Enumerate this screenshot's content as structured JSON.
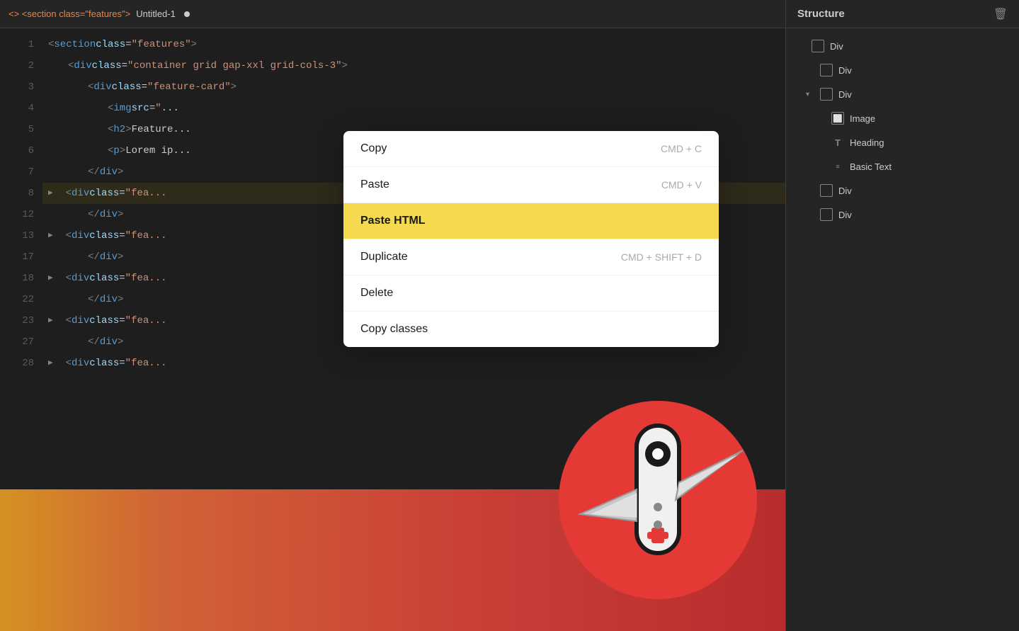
{
  "tab": {
    "chevron_label": "<> <section class=\"features\">",
    "filename": "Untitled-1",
    "dot": true
  },
  "editor": {
    "lines": [
      {
        "num": "1",
        "indent": 0,
        "arrow": false,
        "code": "<section class=\"features\">"
      },
      {
        "num": "2",
        "indent": 1,
        "arrow": false,
        "code": "<div class=\"container grid gap-xxl grid-cols-3\">"
      },
      {
        "num": "3",
        "indent": 2,
        "arrow": false,
        "code": "<div class=\"feature-card\">"
      },
      {
        "num": "4",
        "indent": 3,
        "arrow": false,
        "code": "<img src=\"..."
      },
      {
        "num": "5",
        "indent": 3,
        "arrow": false,
        "code": "<h2>Feature..."
      },
      {
        "num": "6",
        "indent": 3,
        "arrow": false,
        "code": "<p>Lorem ip..."
      },
      {
        "num": "7",
        "indent": 2,
        "arrow": false,
        "code": "</div>"
      },
      {
        "num": "8",
        "indent": 1,
        "arrow": true,
        "code": "<div class=\"fea..."
      },
      {
        "num": "12",
        "indent": 2,
        "arrow": false,
        "code": "</div>"
      },
      {
        "num": "13",
        "indent": 1,
        "arrow": true,
        "code": "<div class=\"fea..."
      },
      {
        "num": "17",
        "indent": 2,
        "arrow": false,
        "code": "</div>"
      },
      {
        "num": "18",
        "indent": 1,
        "arrow": true,
        "code": "<div class=\"fea..."
      },
      {
        "num": "22",
        "indent": 2,
        "arrow": false,
        "code": "</div>"
      },
      {
        "num": "23",
        "indent": 1,
        "arrow": true,
        "code": "<div class=\"fea..."
      },
      {
        "num": "27",
        "indent": 2,
        "arrow": false,
        "code": "</div>"
      },
      {
        "num": "28",
        "indent": 1,
        "arrow": true,
        "code": "<div class=\"fea..."
      }
    ]
  },
  "context_menu": {
    "items": [
      {
        "label": "Copy",
        "shortcut": "CMD + C",
        "active": false
      },
      {
        "label": "Paste",
        "shortcut": "CMD + V",
        "active": false
      },
      {
        "label": "Paste HTML",
        "shortcut": "",
        "active": true
      },
      {
        "label": "Duplicate",
        "shortcut": "CMD + SHIFT + D",
        "active": false
      },
      {
        "label": "Delete",
        "shortcut": "",
        "active": false
      },
      {
        "label": "Copy classes",
        "shortcut": "",
        "active": false
      }
    ]
  },
  "structure_panel": {
    "title": "Structure",
    "items": [
      {
        "label": "Div",
        "indent": 0,
        "chevron": false,
        "icon": "box",
        "selected": false
      },
      {
        "label": "Div",
        "indent": 1,
        "chevron": false,
        "icon": "box",
        "selected": false
      },
      {
        "label": "Div",
        "indent": 1,
        "chevron": true,
        "icon": "box",
        "selected": false
      },
      {
        "label": "Image",
        "indent": 2,
        "chevron": false,
        "icon": "img",
        "selected": false
      },
      {
        "label": "Heading",
        "indent": 2,
        "chevron": false,
        "icon": "text",
        "selected": false
      },
      {
        "label": "Basic Text",
        "indent": 2,
        "chevron": false,
        "icon": "lines",
        "selected": false
      },
      {
        "label": "Div",
        "indent": 1,
        "chevron": false,
        "icon": "box",
        "selected": false
      },
      {
        "label": "Div",
        "indent": 1,
        "chevron": false,
        "icon": "box",
        "selected": false
      }
    ]
  }
}
